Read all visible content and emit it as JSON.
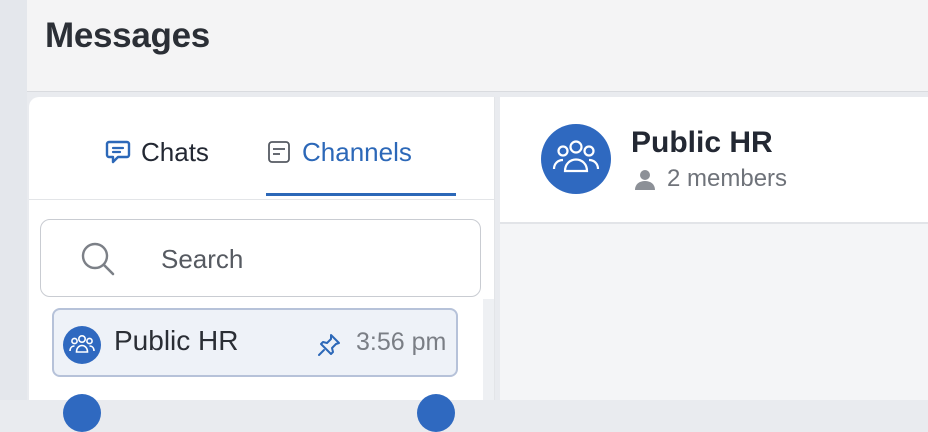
{
  "header": {
    "title": "Messages"
  },
  "tabs": [
    {
      "label": "Chats",
      "icon": "chat-bubble-icon",
      "active": false
    },
    {
      "label": "Channels",
      "icon": "channel-icon",
      "active": true
    }
  ],
  "search": {
    "placeholder": "Search",
    "value": ""
  },
  "channels": [
    {
      "name": "Public HR",
      "time": "3:56 pm",
      "pinned": true,
      "selected": true
    }
  ],
  "conversation": {
    "title": "Public HR",
    "members": "2 members"
  },
  "colors": {
    "accent": "#2c68b8",
    "avatar": "#2f69c0"
  }
}
